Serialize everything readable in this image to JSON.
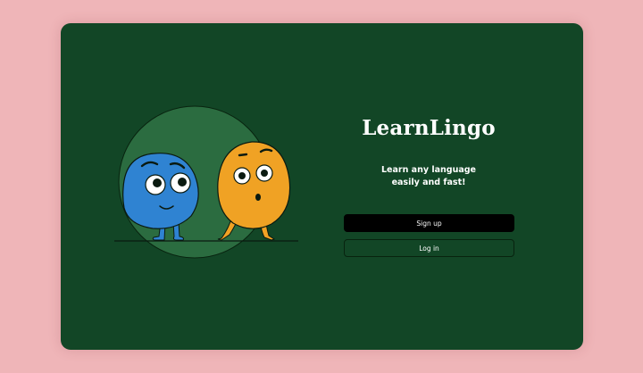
{
  "app": {
    "title": "LearnLingo",
    "tagline_line1": "Learn any language",
    "tagline_line2": "easily and fast!"
  },
  "actions": {
    "signup_label": "Sign up",
    "login_label": "Log in"
  },
  "colors": {
    "page_background": "#efb5b8",
    "window_background": "#124626",
    "circle": "#2b6c40",
    "blue_character": "#2f83d2",
    "orange_character": "#f0a224",
    "signup_button": "#000000"
  },
  "illustration": {
    "characters": [
      "blue-blob-character",
      "orange-blob-character"
    ]
  }
}
